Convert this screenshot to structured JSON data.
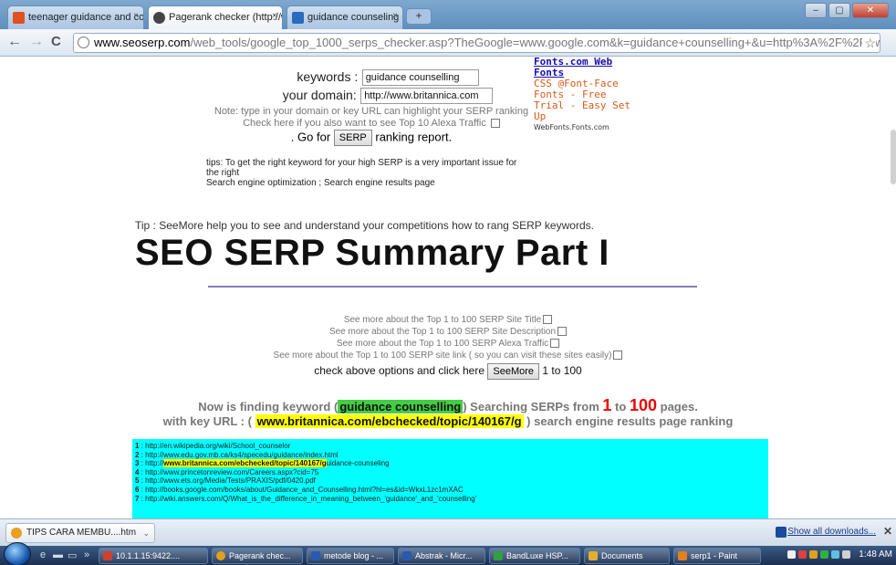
{
  "browser": {
    "tabs": [
      {
        "label": "teenager guidance and cou",
        "active": false,
        "icon_color": "#e05020"
      },
      {
        "label": "Pagerank checker (http://w",
        "active": true,
        "icon_color": "#444444"
      },
      {
        "label": "guidance counseling -- Brit",
        "active": false,
        "icon_color": "#2a6abf"
      }
    ],
    "new_tab_label": "+",
    "window_controls": {
      "minimize": "‒",
      "maximize": "▢",
      "close": "✕"
    },
    "nav": {
      "back": "←",
      "forward": "→",
      "reload": "C"
    },
    "url_host": "www.seoserp.com",
    "url_path": "/web_tools/google_top_1000_serps_checker.asp?TheGoogle=www.google.com&k=guidance+counselling+&u=http%3A%2F%2Fwww.britannica.com",
    "star": "☆"
  },
  "form": {
    "keywords_label": "keywords :",
    "keywords_value": "guidance counselling",
    "domain_label": "your domain:",
    "domain_value": "http://www.britannica.com",
    "note": "Note: type in your domain or key URL can highlight your SERP ranking",
    "alexa_check": "Check here if you also want to see Top 10 Alexa Traffic",
    "go_prefix": ". Go for",
    "serp_button": "SERP",
    "go_suffix": "ranking report."
  },
  "ad": {
    "title": "Fonts.com Web Fonts",
    "text": "CSS @Font-Face Fonts - Free Trial - Easy Set Up",
    "url": "WebFonts.Fonts.com"
  },
  "tips": {
    "line1": "tips: To get the right keyword for your high SERP is a very important issue for the right",
    "line2": "Search engine optimization ;  Search engine results page"
  },
  "tip_seemore": "Tip : SeeMore help you to see and understand your competitions how to rang SERP keywords.",
  "summary_title": "SEO SERP Summary Part I",
  "options": {
    "items": [
      "See more about the Top 1 to 100 SERP Site Title",
      "See more about the Top 1 to 100 SERP Site Description",
      "See more about the Top 1 to 100 SERP Alexa Traffic",
      "See more about the Top 1 to 100 SERP site link ( so you can visit these sites easily)"
    ],
    "check_text": "check above options and click here",
    "seemore_button": "SeeMore",
    "range": "1 to 100"
  },
  "finding": {
    "prefix": "Now is finding keyword (",
    "keyword": "guidance counselling",
    "middle": ") Searching SERPs from",
    "from": "1",
    "to_word": "to",
    "to": "100",
    "suffix": "pages.",
    "url_prefix": "with key URL : (",
    "url": "www.britannica.com/ebchecked/topic/140167/g",
    "url_suffix": ") search engine results page ranking"
  },
  "results": [
    {
      "n": "1",
      "url": "http://en.wikipedia.org/wiki/School_counselor"
    },
    {
      "n": "2",
      "url": "http://www.edu.gov.mb.ca/ks4/specedu/guidance/index.html"
    },
    {
      "n": "3",
      "pre": "http://",
      "hl": "www.britannica.com/ebchecked/topic/140167/g",
      "post": "uidance-counseling"
    },
    {
      "n": "4",
      "url": "http://www.princetonreview.com/Careers.aspx?cid=75"
    },
    {
      "n": "5",
      "url": "http://www.ets.org/Media/Tests/PRAXIS/pdf/0420.pdf"
    },
    {
      "n": "6",
      "url": "http://books.google.com/books/about/Guidance_and_Counselling.html?hl=es&id=WkxL1zc1mXAC"
    },
    {
      "n": "7",
      "url": "http://wiki.answers.com/Q/What_is_the_difference_in_meaning_between_'guidance'_and_'counselling'"
    }
  ],
  "downloads": {
    "item": "TIPS CARA MEMBU....htm",
    "arrow": "⌄",
    "show_all": "Show all downloads...",
    "close": "✕"
  },
  "taskbar": {
    "quick": "»",
    "buttons": [
      {
        "label": "10.1.1.15:9422....",
        "color": "#d04030"
      },
      {
        "label": "Pagerank chec...",
        "color": "#e0a020"
      },
      {
        "label": "metode blog - ...",
        "color": "#2a5ab0"
      },
      {
        "label": "Abstrak - Micr...",
        "color": "#2a5ab0"
      },
      {
        "label": "BandLuxe HSP...",
        "color": "#30a040"
      },
      {
        "label": "Documents",
        "color": "#e0b030"
      },
      {
        "label": "serp1 - Paint",
        "color": "#e08020"
      }
    ],
    "time": "1:48 AM"
  }
}
